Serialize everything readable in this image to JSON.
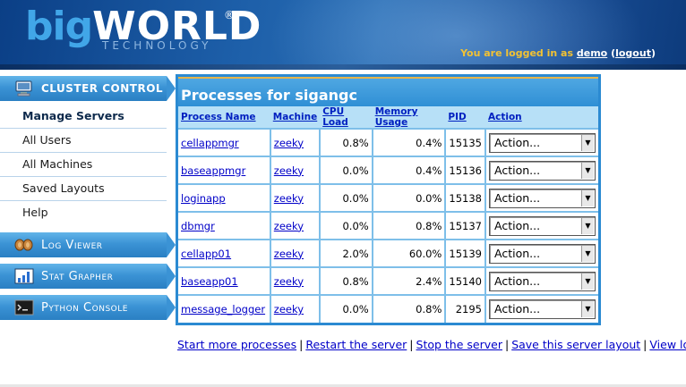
{
  "header": {
    "logo_big": "big",
    "logo_world": "WORLD",
    "logo_reg": "®",
    "logo_tech": "TECHNOLOGY",
    "login_prefix": "You are logged in as",
    "username": "demo",
    "logout_label": "logout"
  },
  "sidebar": {
    "sections": [
      {
        "label": "CLUSTER CONTROL",
        "icon": "cluster-computer-icon"
      },
      {
        "label": "Log Viewer",
        "icon": "log-viewer-icon"
      },
      {
        "label": "Stat Grapher",
        "icon": "bar-chart-icon"
      },
      {
        "label": "Python Console",
        "icon": "console-icon"
      }
    ],
    "cluster_items": [
      {
        "label": "Manage Servers",
        "active": true
      },
      {
        "label": "All Users"
      },
      {
        "label": "All Machines"
      },
      {
        "label": "Saved Layouts"
      },
      {
        "label": "Help"
      }
    ]
  },
  "panel": {
    "title": "Processes for sigangc",
    "columns": [
      "Process Name",
      "Machine",
      "CPU Load",
      "Memory Usage",
      "PID",
      "Action"
    ],
    "rows": [
      {
        "name": "cellappmgr",
        "machine": "zeeky",
        "cpu": "0.8%",
        "mem": "0.4%",
        "pid": "15135",
        "action": "Action..."
      },
      {
        "name": "baseappmgr",
        "machine": "zeeky",
        "cpu": "0.0%",
        "mem": "0.4%",
        "pid": "15136",
        "action": "Action..."
      },
      {
        "name": "loginapp",
        "machine": "zeeky",
        "cpu": "0.0%",
        "mem": "0.0%",
        "pid": "15138",
        "action": "Action..."
      },
      {
        "name": "dbmgr",
        "machine": "zeeky",
        "cpu": "0.0%",
        "mem": "0.8%",
        "pid": "15137",
        "action": "Action..."
      },
      {
        "name": "cellapp01",
        "machine": "zeeky",
        "cpu": "2.0%",
        "mem": "60.0%",
        "pid": "15139",
        "action": "Action..."
      },
      {
        "name": "baseapp01",
        "machine": "zeeky",
        "cpu": "0.8%",
        "mem": "2.4%",
        "pid": "15140",
        "action": "Action..."
      },
      {
        "name": "message_logger",
        "machine": "zeeky",
        "cpu": "0.0%",
        "mem": "0.8%",
        "pid": "2195",
        "action": "Action..."
      }
    ]
  },
  "bottom_links": {
    "start_more": "Start more processes",
    "restart": "Restart the server",
    "stop": "Stop the server",
    "save_layout": "Save this server layout",
    "view_log": "View log",
    "separator": "|"
  },
  "colors": {
    "accent": "#2b8ad2",
    "header_blue": "#1d5fa9",
    "login_yellow": "#f2c233",
    "link": "#0000c8"
  }
}
